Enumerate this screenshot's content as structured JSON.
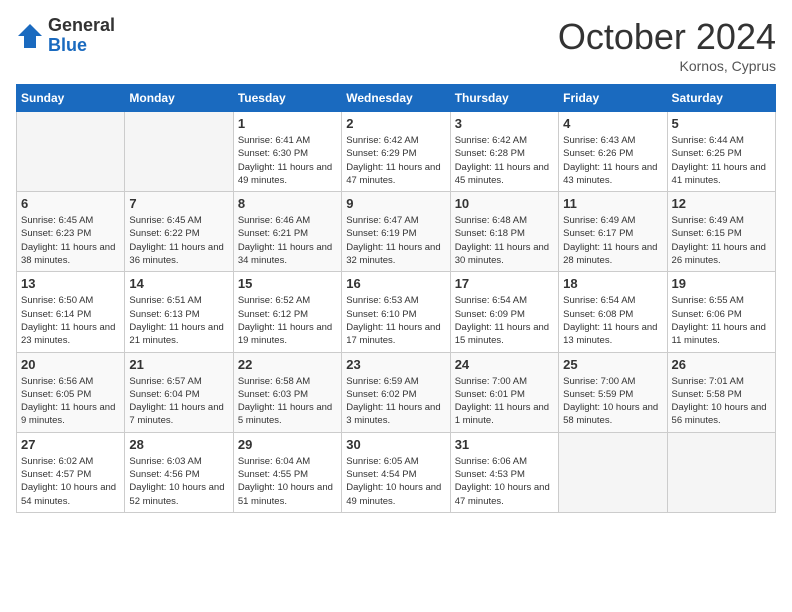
{
  "logo": {
    "general": "General",
    "blue": "Blue"
  },
  "title": "October 2024",
  "location": "Kornos, Cyprus",
  "days_header": [
    "Sunday",
    "Monday",
    "Tuesday",
    "Wednesday",
    "Thursday",
    "Friday",
    "Saturday"
  ],
  "weeks": [
    [
      {
        "day": "",
        "info": ""
      },
      {
        "day": "",
        "info": ""
      },
      {
        "day": "1",
        "info": "Sunrise: 6:41 AM\nSunset: 6:30 PM\nDaylight: 11 hours and 49 minutes."
      },
      {
        "day": "2",
        "info": "Sunrise: 6:42 AM\nSunset: 6:29 PM\nDaylight: 11 hours and 47 minutes."
      },
      {
        "day": "3",
        "info": "Sunrise: 6:42 AM\nSunset: 6:28 PM\nDaylight: 11 hours and 45 minutes."
      },
      {
        "day": "4",
        "info": "Sunrise: 6:43 AM\nSunset: 6:26 PM\nDaylight: 11 hours and 43 minutes."
      },
      {
        "day": "5",
        "info": "Sunrise: 6:44 AM\nSunset: 6:25 PM\nDaylight: 11 hours and 41 minutes."
      }
    ],
    [
      {
        "day": "6",
        "info": "Sunrise: 6:45 AM\nSunset: 6:23 PM\nDaylight: 11 hours and 38 minutes."
      },
      {
        "day": "7",
        "info": "Sunrise: 6:45 AM\nSunset: 6:22 PM\nDaylight: 11 hours and 36 minutes."
      },
      {
        "day": "8",
        "info": "Sunrise: 6:46 AM\nSunset: 6:21 PM\nDaylight: 11 hours and 34 minutes."
      },
      {
        "day": "9",
        "info": "Sunrise: 6:47 AM\nSunset: 6:19 PM\nDaylight: 11 hours and 32 minutes."
      },
      {
        "day": "10",
        "info": "Sunrise: 6:48 AM\nSunset: 6:18 PM\nDaylight: 11 hours and 30 minutes."
      },
      {
        "day": "11",
        "info": "Sunrise: 6:49 AM\nSunset: 6:17 PM\nDaylight: 11 hours and 28 minutes."
      },
      {
        "day": "12",
        "info": "Sunrise: 6:49 AM\nSunset: 6:15 PM\nDaylight: 11 hours and 26 minutes."
      }
    ],
    [
      {
        "day": "13",
        "info": "Sunrise: 6:50 AM\nSunset: 6:14 PM\nDaylight: 11 hours and 23 minutes."
      },
      {
        "day": "14",
        "info": "Sunrise: 6:51 AM\nSunset: 6:13 PM\nDaylight: 11 hours and 21 minutes."
      },
      {
        "day": "15",
        "info": "Sunrise: 6:52 AM\nSunset: 6:12 PM\nDaylight: 11 hours and 19 minutes."
      },
      {
        "day": "16",
        "info": "Sunrise: 6:53 AM\nSunset: 6:10 PM\nDaylight: 11 hours and 17 minutes."
      },
      {
        "day": "17",
        "info": "Sunrise: 6:54 AM\nSunset: 6:09 PM\nDaylight: 11 hours and 15 minutes."
      },
      {
        "day": "18",
        "info": "Sunrise: 6:54 AM\nSunset: 6:08 PM\nDaylight: 11 hours and 13 minutes."
      },
      {
        "day": "19",
        "info": "Sunrise: 6:55 AM\nSunset: 6:06 PM\nDaylight: 11 hours and 11 minutes."
      }
    ],
    [
      {
        "day": "20",
        "info": "Sunrise: 6:56 AM\nSunset: 6:05 PM\nDaylight: 11 hours and 9 minutes."
      },
      {
        "day": "21",
        "info": "Sunrise: 6:57 AM\nSunset: 6:04 PM\nDaylight: 11 hours and 7 minutes."
      },
      {
        "day": "22",
        "info": "Sunrise: 6:58 AM\nSunset: 6:03 PM\nDaylight: 11 hours and 5 minutes."
      },
      {
        "day": "23",
        "info": "Sunrise: 6:59 AM\nSunset: 6:02 PM\nDaylight: 11 hours and 3 minutes."
      },
      {
        "day": "24",
        "info": "Sunrise: 7:00 AM\nSunset: 6:01 PM\nDaylight: 11 hours and 1 minute."
      },
      {
        "day": "25",
        "info": "Sunrise: 7:00 AM\nSunset: 5:59 PM\nDaylight: 10 hours and 58 minutes."
      },
      {
        "day": "26",
        "info": "Sunrise: 7:01 AM\nSunset: 5:58 PM\nDaylight: 10 hours and 56 minutes."
      }
    ],
    [
      {
        "day": "27",
        "info": "Sunrise: 6:02 AM\nSunset: 4:57 PM\nDaylight: 10 hours and 54 minutes."
      },
      {
        "day": "28",
        "info": "Sunrise: 6:03 AM\nSunset: 4:56 PM\nDaylight: 10 hours and 52 minutes."
      },
      {
        "day": "29",
        "info": "Sunrise: 6:04 AM\nSunset: 4:55 PM\nDaylight: 10 hours and 51 minutes."
      },
      {
        "day": "30",
        "info": "Sunrise: 6:05 AM\nSunset: 4:54 PM\nDaylight: 10 hours and 49 minutes."
      },
      {
        "day": "31",
        "info": "Sunrise: 6:06 AM\nSunset: 4:53 PM\nDaylight: 10 hours and 47 minutes."
      },
      {
        "day": "",
        "info": ""
      },
      {
        "day": "",
        "info": ""
      }
    ]
  ]
}
